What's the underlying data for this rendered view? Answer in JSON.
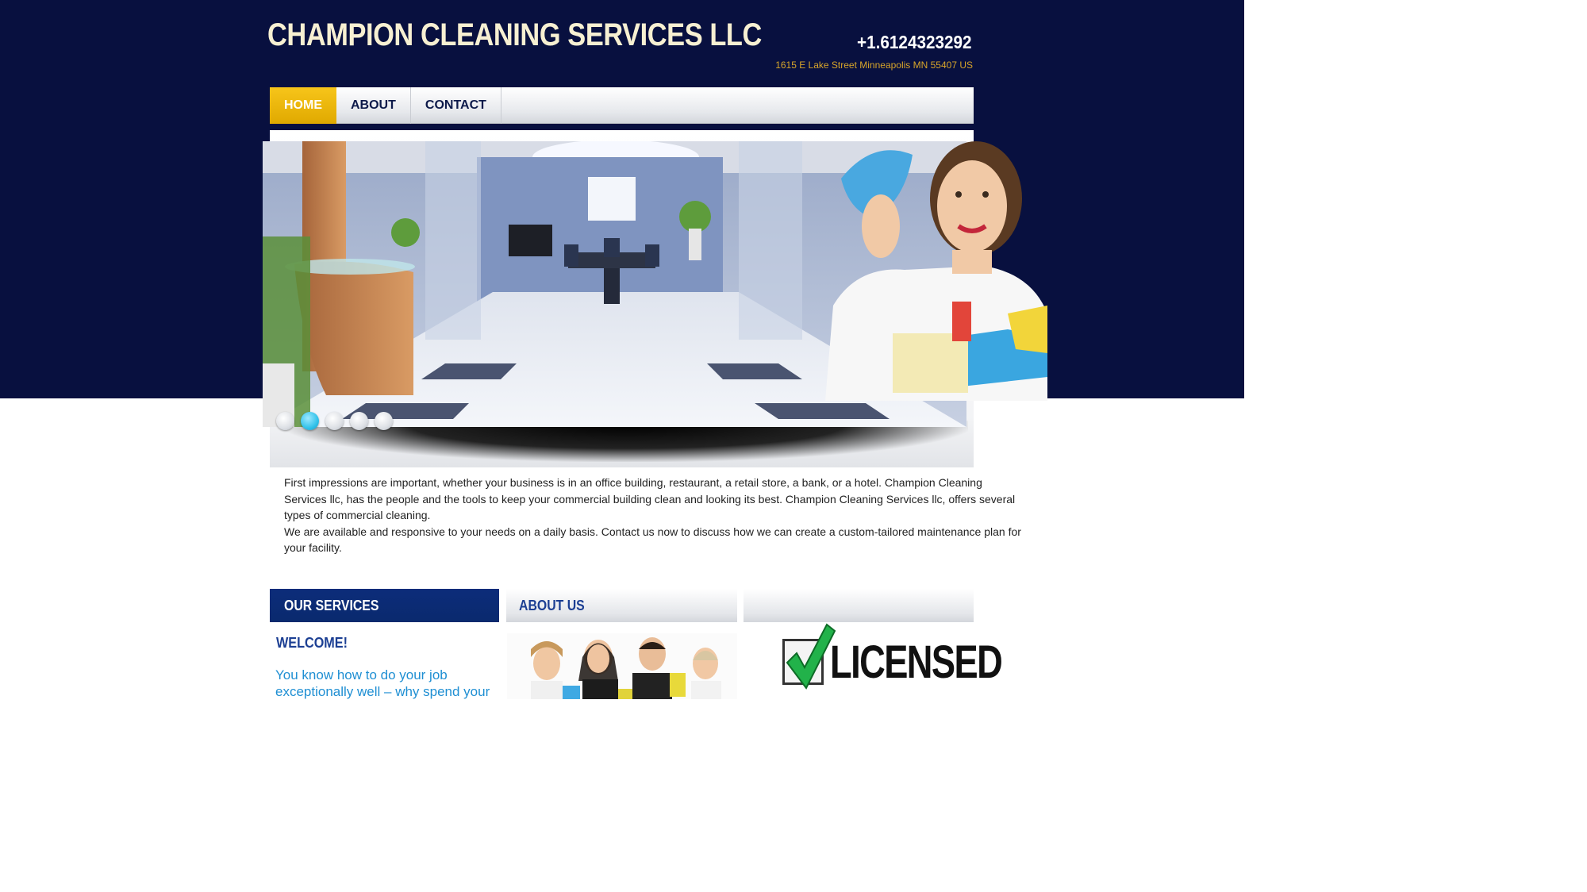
{
  "header": {
    "title": "CHAMPION CLEANING SERVICES LLC",
    "phone": "+1.6124323292",
    "address": "1615 E Lake Street Minneapolis MN 55407 US"
  },
  "nav": {
    "items": [
      {
        "label": "HOME",
        "active": true
      },
      {
        "label": "ABOUT",
        "active": false
      },
      {
        "label": "CONTACT",
        "active": false
      }
    ]
  },
  "slider": {
    "dot_count": 5,
    "active_dot": 2
  },
  "intro": {
    "paragraph1": "First impressions are important, whether your business is in an office building, restaurant,  a retail store, a bank, or a hotel. Champion Cleaning Services llc,  has the people and the tools to keep your commercial building clean and looking its best. Champion Cleaning Services llc, offers several types of commercial cleaning.",
    "paragraph2": "We are available and responsive to your needs on a daily basis.  Contact us now to discuss how we can create a custom-tailored maintenance plan for your facility."
  },
  "columns": {
    "services_heading": "OUR SERVICES",
    "about_heading": "ABOUT US",
    "third_heading": "",
    "welcome_title": "WELCOME!",
    "welcome_text": "You know how to do your job exceptionally well – why spend your",
    "licensed_text": "LICENSED"
  },
  "colors": {
    "header_bg": "#08103f",
    "title": "#f7f0d2",
    "address": "#d7a52a",
    "nav_active": "#f0b70f",
    "services_heading_bg": "#0a2a6e",
    "accent_blue": "#1f8fd3"
  }
}
